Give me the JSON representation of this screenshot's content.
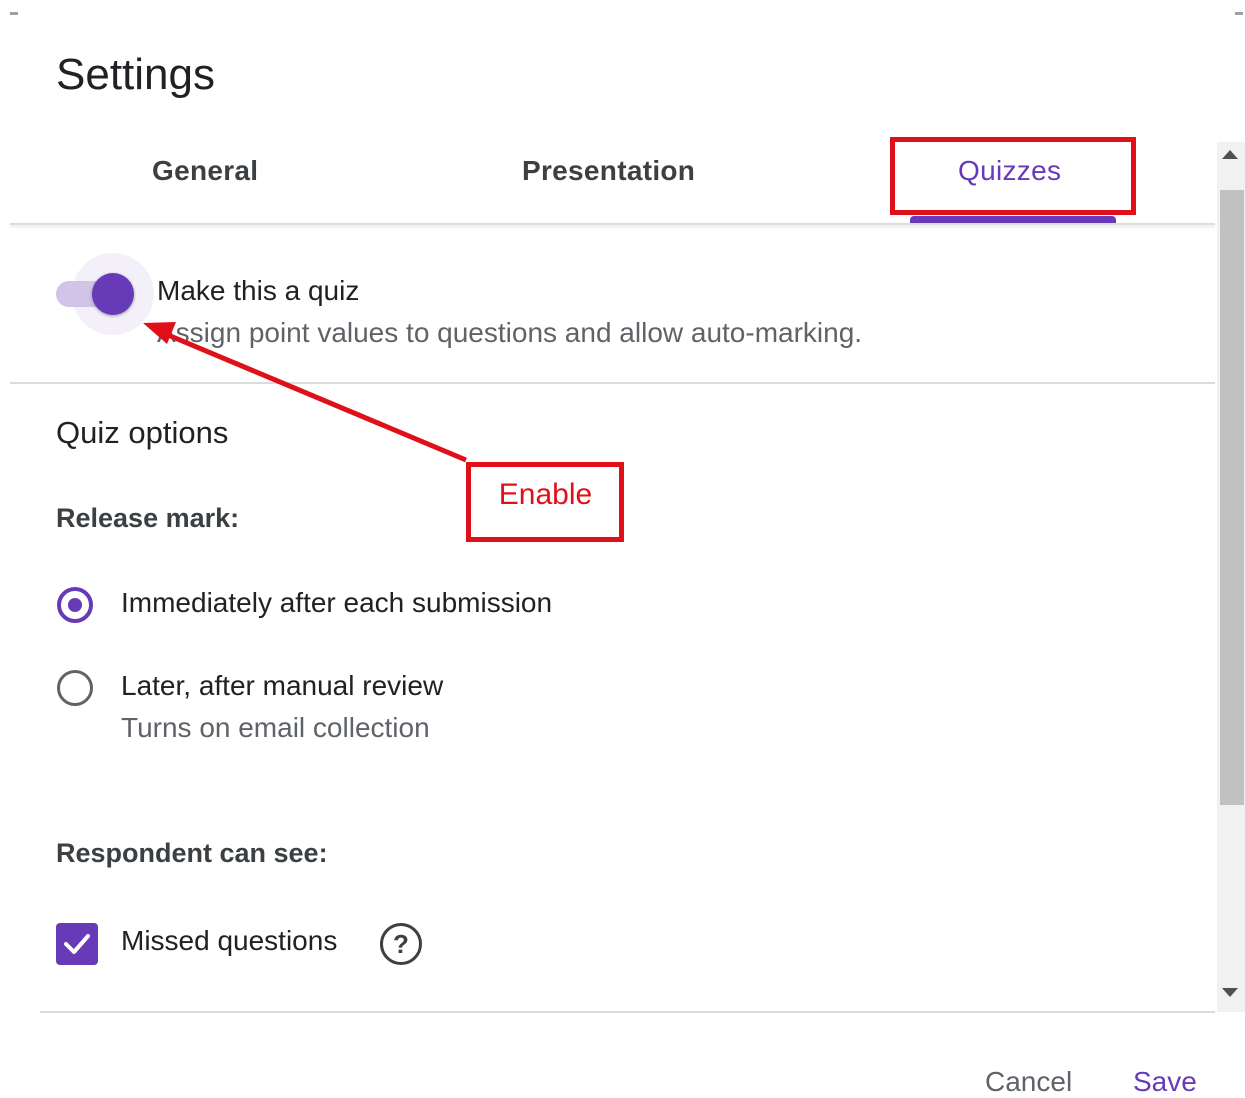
{
  "dialog": {
    "title": "Settings"
  },
  "tabs": [
    {
      "label": "General",
      "active": false
    },
    {
      "label": "Presentation",
      "active": false
    },
    {
      "label": "Quizzes",
      "active": true
    }
  ],
  "quiz_toggle": {
    "on": true,
    "title": "Make this a quiz",
    "description": "Assign point values to questions and allow auto-marking."
  },
  "quiz_options": {
    "heading": "Quiz options",
    "release_mark": {
      "label": "Release mark:",
      "options": [
        {
          "label": "Immediately after each submission",
          "selected": true
        },
        {
          "label": "Later, after manual review",
          "sublabel": "Turns on email collection",
          "selected": false
        }
      ]
    },
    "respondent": {
      "label": "Respondent can see:",
      "items": [
        {
          "label": "Missed questions",
          "checked": true,
          "icon": "help-icon",
          "icon_glyph": "?"
        }
      ]
    }
  },
  "footer": {
    "cancel_label": "Cancel",
    "save_label": "Save"
  },
  "annotation": {
    "label": "Enable",
    "color": "#e0101a"
  },
  "colors": {
    "accent": "#673ab7",
    "text": "#202124",
    "secondary_text": "#5f6368",
    "divider": "#dadce0"
  }
}
